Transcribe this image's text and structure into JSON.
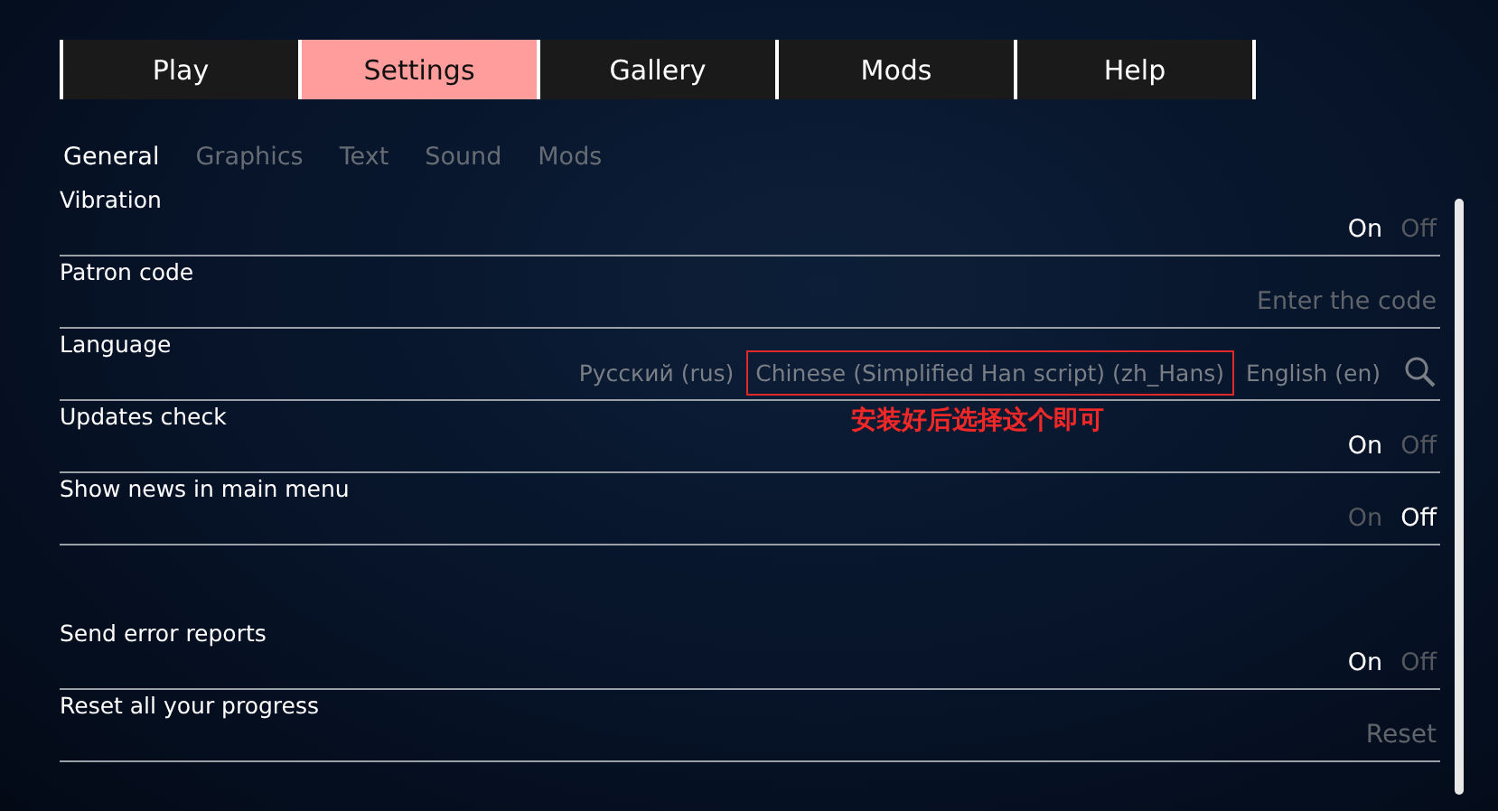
{
  "tabs": [
    {
      "label": "Play",
      "selected": false
    },
    {
      "label": "Settings",
      "selected": true
    },
    {
      "label": "Gallery",
      "selected": false
    },
    {
      "label": "Mods",
      "selected": false
    },
    {
      "label": "Help",
      "selected": false
    }
  ],
  "subtabs": [
    {
      "label": "General",
      "selected": true
    },
    {
      "label": "Graphics",
      "selected": false
    },
    {
      "label": "Text",
      "selected": false
    },
    {
      "label": "Sound",
      "selected": false
    },
    {
      "label": "Mods",
      "selected": false
    }
  ],
  "rows": [
    {
      "kind": "toggle",
      "label": "Vibration",
      "options": [
        {
          "label": "On",
          "selected": true
        },
        {
          "label": "Off",
          "selected": false
        }
      ]
    },
    {
      "kind": "field",
      "label": "Patron code",
      "placeholder": "Enter the code"
    },
    {
      "kind": "language",
      "label": "Language",
      "options": [
        {
          "label": "Русский (rus)",
          "boxed": false
        },
        {
          "label": "Chinese (Simplified Han script) (zh_Hans)",
          "boxed": true
        },
        {
          "label": "English (en)",
          "boxed": false
        }
      ],
      "annotation": "安装好后选择这个即可"
    },
    {
      "kind": "toggle",
      "label": "Updates check",
      "options": [
        {
          "label": "On",
          "selected": true
        },
        {
          "label": "Off",
          "selected": false
        }
      ]
    },
    {
      "kind": "toggle",
      "label": "Show news in main menu",
      "options": [
        {
          "label": "On",
          "selected": false
        },
        {
          "label": "Off",
          "selected": true
        }
      ]
    },
    {
      "kind": "spacer"
    },
    {
      "kind": "toggle",
      "label": "Send error reports",
      "options": [
        {
          "label": "On",
          "selected": true
        },
        {
          "label": "Off",
          "selected": false
        }
      ]
    },
    {
      "kind": "action",
      "label": "Reset all your progress",
      "action": "Reset"
    }
  ]
}
